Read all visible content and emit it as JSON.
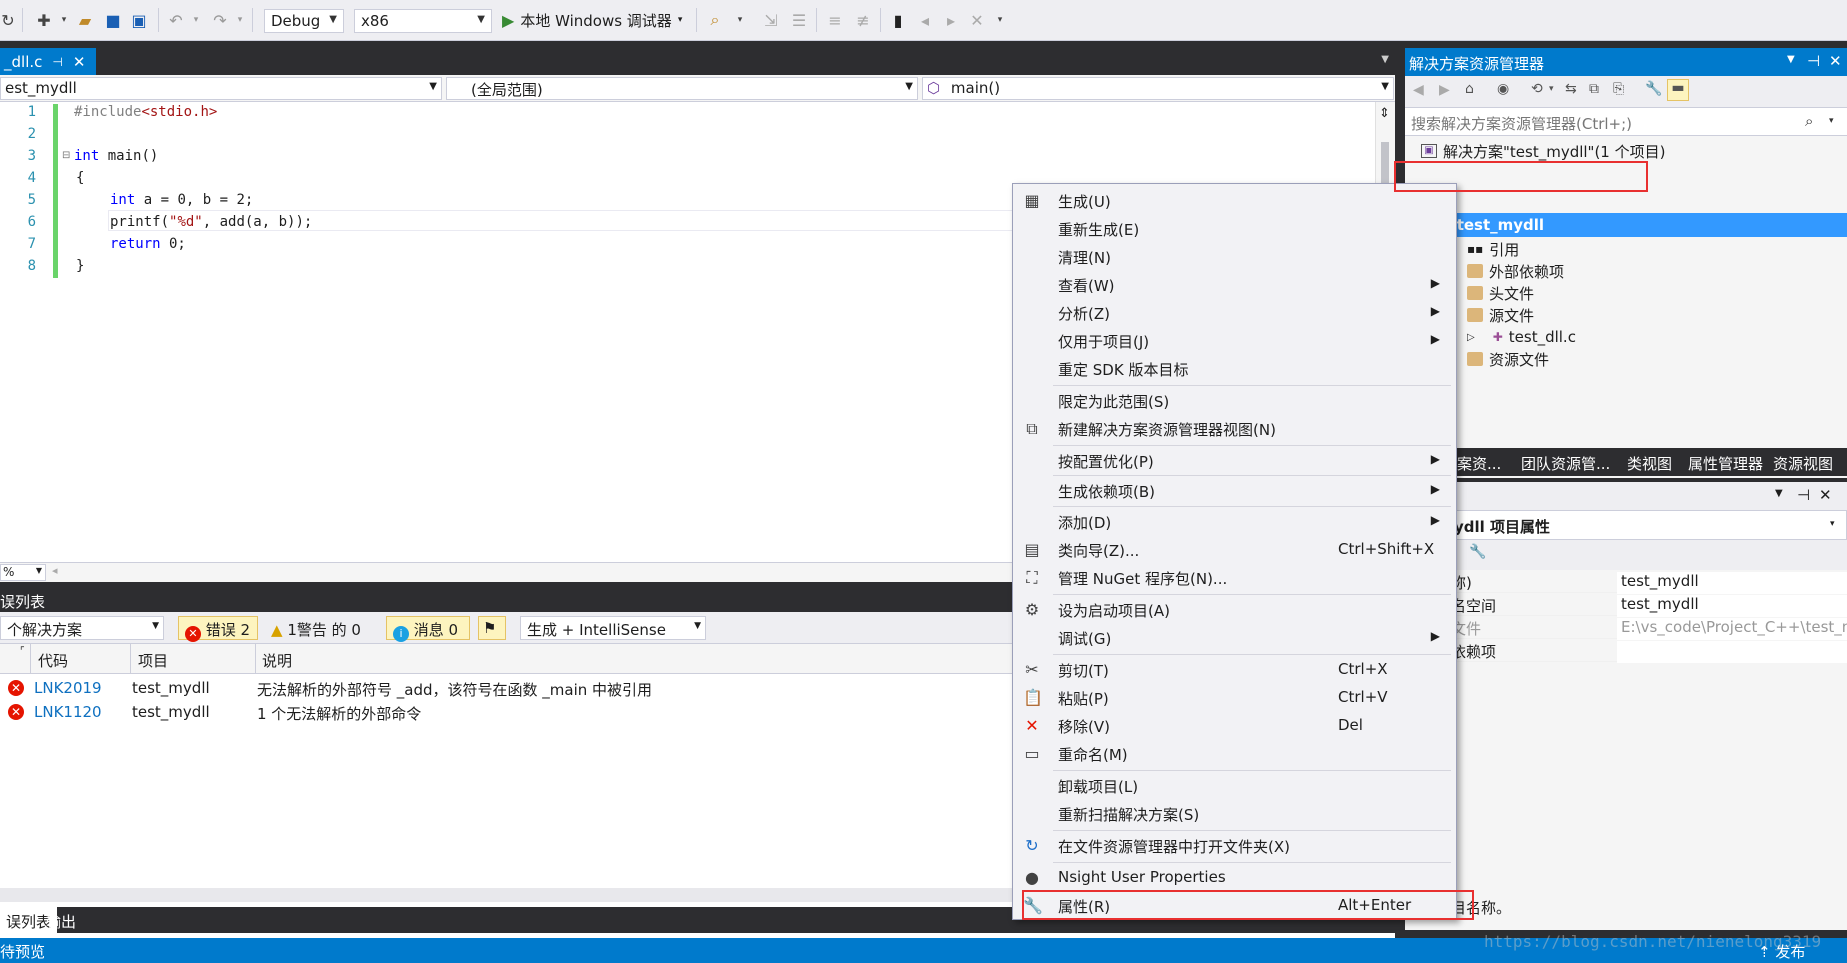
{
  "toolbar": {
    "config": "Debug",
    "platform": "x86",
    "run_label": "本地 Windows 调试器"
  },
  "editor": {
    "tab_title": "_dll.c",
    "nav_project": "est_mydll",
    "nav_scope": "(全局范围)",
    "nav_member": "main()",
    "line_numbers": [
      "1",
      "2",
      "3",
      "4",
      "5",
      "6",
      "7",
      "8"
    ],
    "code": {
      "l1_pp": "#include",
      "l1_rest": "<stdio.h>",
      "l3_kw": "int",
      "l3_rest": " main()",
      "l4": "{",
      "l5_kw": "int",
      "l5_rest": " a = 0, b = 2;",
      "l6_a": "printf(",
      "l6_str": "\"%d\"",
      "l6_b": ", add(a, b));",
      "l7_kw": "return",
      "l7_rest": " 0;",
      "l8": "}"
    },
    "zoom": "%"
  },
  "errlist": {
    "title": "误列表",
    "scope": "个解决方案",
    "errors_label": "错误 2",
    "warnings_label": "1警告 的 0",
    "messages_label": "消息 0",
    "build_filter": "生成 + IntelliSense",
    "columns": [
      "代码",
      "项目",
      "说明"
    ],
    "rows": [
      {
        "code": "LNK2019",
        "project": "test_mydll",
        "desc": "无法解析的外部符号 _add，该符号在函数 _main 中被引用"
      },
      {
        "code": "LNK1120",
        "project": "test_mydll",
        "desc": "1 个无法解析的外部命令"
      }
    ]
  },
  "bottom_tabs": [
    "误列表",
    "输出"
  ],
  "statusbar": {
    "left": "待预览",
    "right": "发布"
  },
  "solex": {
    "title": "解决方案资源管理器",
    "search_placeholder": "搜索解决方案资源管理器(Ctrl+;)",
    "solution": "解决方案\"test_mydll\"(1 个项目)",
    "project": "test_mydll",
    "items": {
      "ref": "引用",
      "ext": "外部依赖项",
      "hdr": "头文件",
      "src": "源文件",
      "file": "test_dll.c",
      "res": "资源文件"
    },
    "tabs": [
      "案资...",
      "团队资源管...",
      "类视图",
      "属性管理器",
      "资源视图"
    ]
  },
  "props": {
    "object": "ydll 项目属性",
    "rows": [
      {
        "k": "称)",
        "v": "test_mydll"
      },
      {
        "k": "名空间",
        "v": "test_mydll"
      },
      {
        "k": "文件",
        "v": "E:\\vs_code\\Project_C++\\test_m"
      },
      {
        "k": "依赖项",
        "v": ""
      }
    ],
    "desc": "目名称。"
  },
  "menu": {
    "items": [
      {
        "label": "生成(U)",
        "icon": "build-icon"
      },
      {
        "label": "重新生成(E)"
      },
      {
        "label": "清理(N)"
      },
      {
        "label": "查看(W)"
      },
      {
        "label": "分析(Z)"
      },
      {
        "label": "仅用于项目(J)"
      },
      {
        "label": "重定 SDK 版本目标"
      },
      {
        "label": "限定为此范围(S)"
      },
      {
        "label": "新建解决方案资源管理器视图(N)",
        "icon": "new-view-icon"
      },
      {
        "label": "按配置优化(P)"
      },
      {
        "label": "生成依赖项(B)"
      },
      {
        "label": "添加(D)"
      },
      {
        "label": "类向导(Z)...",
        "shortcut": "Ctrl+Shift+X",
        "icon": "class-wizard-icon"
      },
      {
        "label": "管理 NuGet 程序包(N)...",
        "icon": "nuget-icon"
      },
      {
        "label": "设为启动项目(A)",
        "icon": "gear-icon"
      },
      {
        "label": "调试(G)"
      },
      {
        "label": "剪切(T)",
        "shortcut": "Ctrl+X",
        "icon": "cut-icon"
      },
      {
        "label": "粘贴(P)",
        "shortcut": "Ctrl+V",
        "icon": "paste-icon"
      },
      {
        "label": "移除(V)",
        "shortcut": "Del",
        "icon": "remove-icon"
      },
      {
        "label": "重命名(M)",
        "icon": "rename-icon"
      },
      {
        "label": "卸载项目(L)"
      },
      {
        "label": "重新扫描解决方案(S)"
      },
      {
        "label": "在文件资源管理器中打开文件夹(X)",
        "icon": "open-folder-icon"
      },
      {
        "label": "Nsight User Properties",
        "icon": "nsight-icon"
      },
      {
        "label": "属性(R)",
        "shortcut": "Alt+Enter",
        "icon": "wrench-icon"
      }
    ]
  },
  "watermark": "https://blog.csdn.net/nienelong3319"
}
